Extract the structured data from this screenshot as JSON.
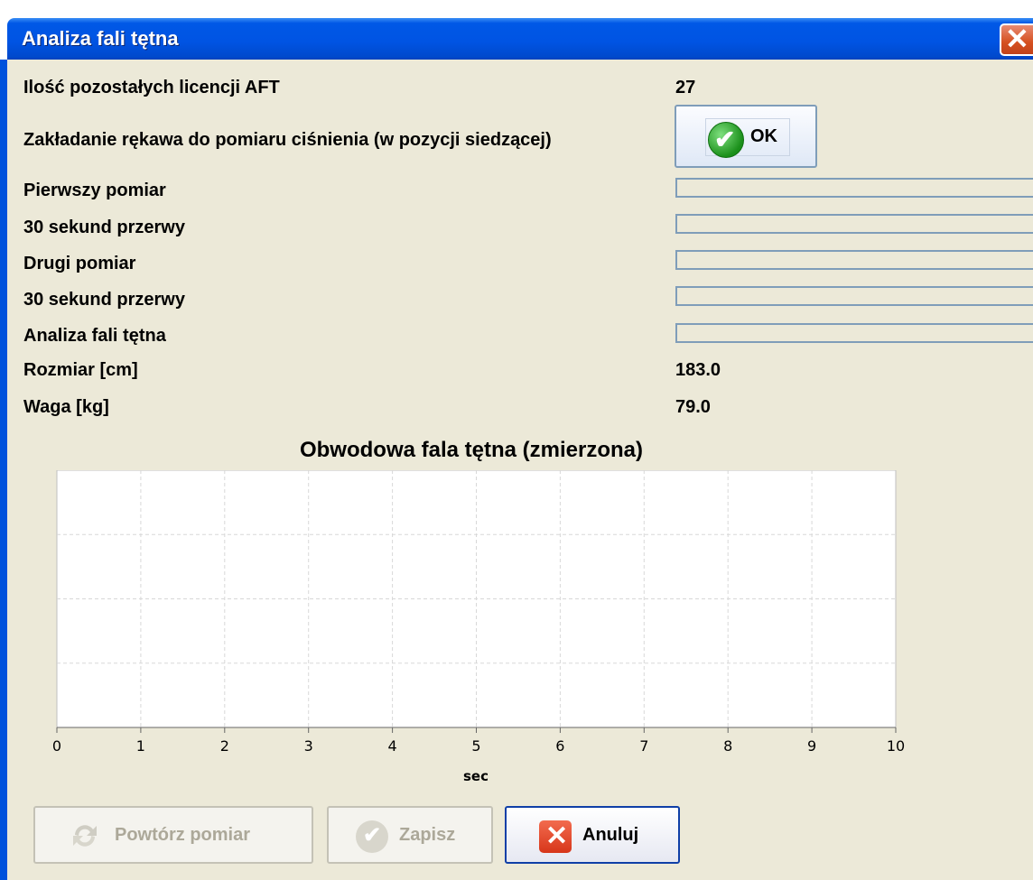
{
  "window": {
    "title": "Analiza fali tętna",
    "close_glyph": "✕"
  },
  "fields": {
    "licenses_label": "Ilość pozostałych licencji AFT",
    "licenses_value": "27",
    "cuff_label": "Zakładanie rękawa do pomiaru ciśnienia  (w pozycji siedzącej)",
    "ok_label": "OK",
    "steps": [
      {
        "label": "Pierwszy pomiar",
        "progress": 0
      },
      {
        "label": "30 sekund przerwy",
        "progress": 0
      },
      {
        "label": "Drugi pomiar",
        "progress": 0
      },
      {
        "label": "30 sekund przerwy",
        "progress": 0
      },
      {
        "label": "Analiza fali tętna",
        "progress": 0
      }
    ],
    "size_label": "Rozmiar [cm]",
    "size_value": "183.0",
    "weight_label": "Waga [kg]",
    "weight_value": "79.0"
  },
  "chart_data": {
    "type": "line",
    "title": "Obwodowa fala tętna (zmierzona)",
    "xlabel": "sec",
    "ylabel": "",
    "xlim": [
      0,
      10
    ],
    "x_ticks": [
      "0",
      "1",
      "2",
      "3",
      "4",
      "5",
      "6",
      "7",
      "8",
      "9",
      "10"
    ],
    "series": [],
    "grid": true
  },
  "buttons": {
    "repeat": "Powtórz pomiar",
    "save": "Zapisz",
    "cancel": "Anuluj",
    "check_glyph": "✔",
    "cancel_glyph": "✕"
  },
  "icons": {
    "ok": "check-circle-icon",
    "repeat": "refresh-icon",
    "save": "check-circle-icon",
    "cancel": "close-icon"
  },
  "colors": {
    "titlebar": "#0054e3",
    "background": "#ece9d8",
    "progress_border": "#7f9db9",
    "accent_green": "#1a8f1a",
    "cancel_red": "#d7361a"
  }
}
